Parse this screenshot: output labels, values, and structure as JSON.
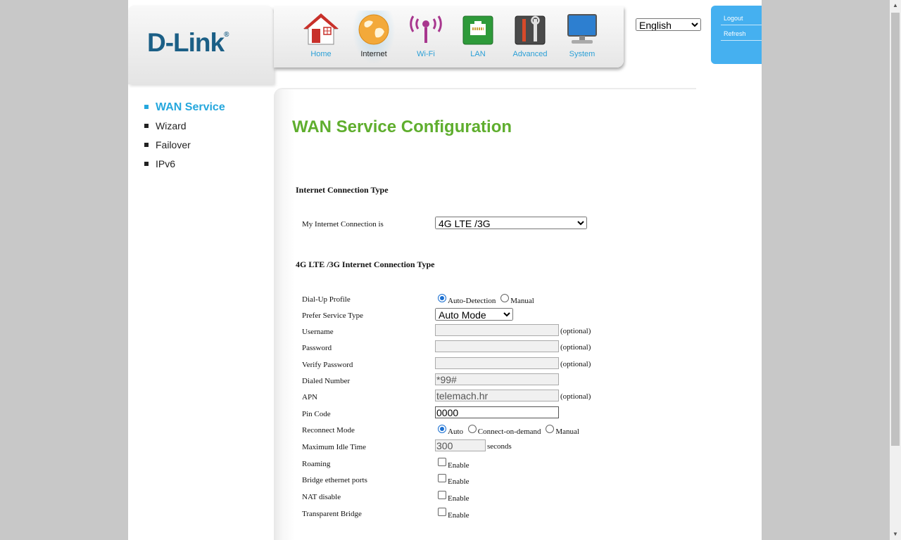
{
  "brand": {
    "name": "D-Link",
    "mark": "®"
  },
  "nav": [
    {
      "label": "Home",
      "icon": "home-icon",
      "active": false
    },
    {
      "label": "Internet",
      "icon": "globe-icon",
      "active": true
    },
    {
      "label": "Wi-Fi",
      "icon": "wifi-antenna-icon",
      "active": false
    },
    {
      "label": "LAN",
      "icon": "ethernet-port-icon",
      "active": false
    },
    {
      "label": "Advanced",
      "icon": "tools-icon",
      "active": false
    },
    {
      "label": "System",
      "icon": "monitor-icon",
      "active": false
    }
  ],
  "language": {
    "selected": "English"
  },
  "user_menu": {
    "logout": "Logout",
    "refresh": "Refresh"
  },
  "sidebar": {
    "items": [
      {
        "label": "WAN Service",
        "active": true
      },
      {
        "label": "Wizard",
        "active": false
      },
      {
        "label": "Failover",
        "active": false
      },
      {
        "label": "IPv6",
        "active": false
      }
    ]
  },
  "main": {
    "title": "WAN Service Configuration",
    "section1_title": "Internet Connection Type",
    "connection_label": "My Internet Connection is",
    "connection_value": "4G LTE /3G",
    "section2_title": "4G LTE /3G Internet Connection Type",
    "fields": {
      "dialup_profile": {
        "label": "Dial-Up Profile",
        "opt_auto": "Auto-Detection",
        "opt_manual": "Manual",
        "selected": "Auto-Detection"
      },
      "service_type": {
        "label": "Prefer Service Type",
        "value": "Auto Mode"
      },
      "username": {
        "label": "Username",
        "value": "",
        "note": "(optional)"
      },
      "password": {
        "label": "Password",
        "value": "",
        "note": "(optional)"
      },
      "verify_password": {
        "label": "Verify Password",
        "value": "",
        "note": "(optional)"
      },
      "dialed_number": {
        "label": "Dialed Number",
        "value": "*99#"
      },
      "apn": {
        "label": "APN",
        "value": "telemach.hr",
        "note": "(optional)"
      },
      "pin_code": {
        "label": "Pin Code",
        "value": "0000"
      },
      "reconnect_mode": {
        "label": "Reconnect Mode",
        "opt_auto": "Auto",
        "opt_ondemand": "Connect-on-demand",
        "opt_manual": "Manual",
        "selected": "Auto"
      },
      "max_idle_time": {
        "label": "Maximum Idle Time",
        "value": "300",
        "unit": "seconds"
      },
      "roaming": {
        "label": "Roaming",
        "option": "Enable",
        "checked": false
      },
      "bridge_ports": {
        "label": "Bridge ethernet ports",
        "option": "Enable",
        "checked": false
      },
      "nat_disable": {
        "label": "NAT disable",
        "option": "Enable",
        "checked": false
      },
      "transparent_bridge": {
        "label": "Transparent Bridge",
        "option": "Enable",
        "checked": false
      }
    }
  },
  "colors": {
    "title_green": "#5fae2e",
    "accent_blue": "#25a7dd",
    "user_box_blue": "#45b0f0",
    "brand_blue": "#1b5f86"
  }
}
